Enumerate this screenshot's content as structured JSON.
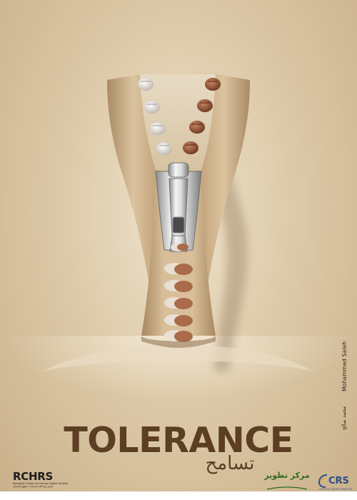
{
  "poster": {
    "title": "TOLERANCE",
    "title_arabic": "تسامح",
    "artist_credit": "Mohammed Saleh",
    "artist_credit_arabic": "محمد صالح"
  },
  "logos": {
    "rchrs": {
      "name": "RCHRS",
      "subtitle_en": "Ramallah Center for Human Rights Studies",
      "subtitle_ar": "مركز رام الله لدراسات حقوق الانسان"
    },
    "ngo": {
      "name_ar": "مركز تطوير",
      "subtitle_en": "NGO Development Center"
    },
    "crs": {
      "name": "CRS",
      "subtitle": "CATHOLIC RELIEF SERVICES"
    }
  },
  "colors": {
    "background": "#ddcaa8",
    "title": "#5c3f22",
    "fabric": "#c9ab85",
    "metal": "#d8d8d8"
  },
  "icons": [
    "fist-icon",
    "handshake-icon",
    "zipper-pull-icon"
  ]
}
